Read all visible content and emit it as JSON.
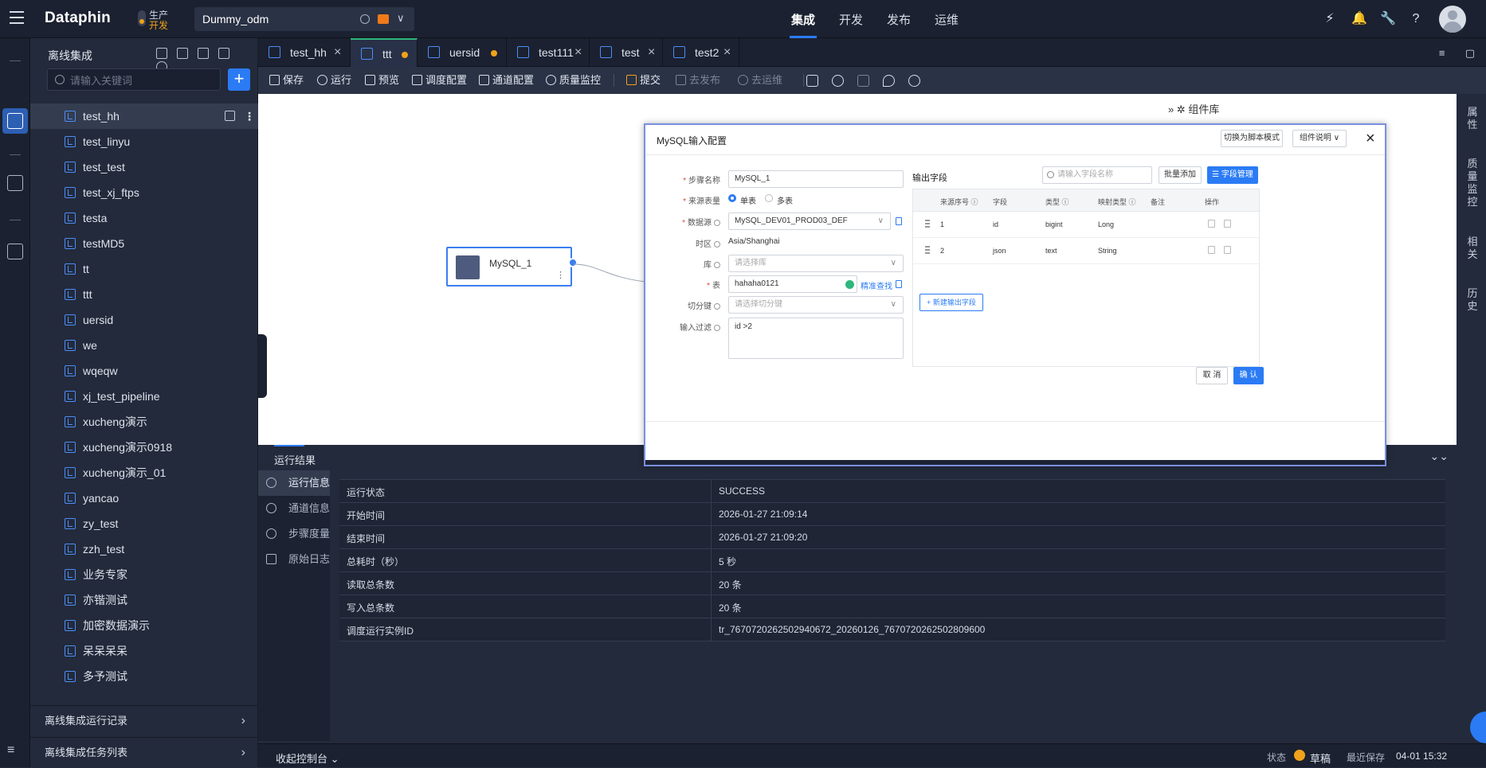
{
  "topbar": {
    "logo": "Dataphin",
    "env_line1": "生产",
    "env_line2": "开发",
    "project": "Dummy_odm",
    "nav": [
      "集成",
      "开发",
      "发布",
      "运维"
    ],
    "active_nav": "集成"
  },
  "sidebar": {
    "title": "离线集成",
    "search_placeholder": "请输入关键词",
    "items": [
      "test_hh",
      "test_linyu",
      "test_test",
      "test_xj_ftps",
      "testa",
      "testMD5",
      "tt",
      "ttt",
      "uersid",
      "we",
      "wqeqw",
      "xj_test_pipeline",
      "xucheng演示",
      "xucheng演示0918",
      "xucheng演示_01",
      "yancao",
      "zy_test",
      "zzh_test",
      "业务专家",
      "亦锴测试",
      "加密数据演示",
      "呆呆呆呆",
      "多予测试"
    ],
    "footer1": "离线集成运行记录",
    "footer2": "离线集成任务列表"
  },
  "tabs": [
    {
      "label": "test_hh",
      "modified": false,
      "active": false
    },
    {
      "label": "ttt",
      "modified": true,
      "active": true
    },
    {
      "label": "uersid",
      "modified": true,
      "active": false
    },
    {
      "label": "test111",
      "modified": false,
      "active": false
    },
    {
      "label": "test",
      "modified": false,
      "active": false
    },
    {
      "label": "test2",
      "modified": false,
      "active": false
    }
  ],
  "toolbar": {
    "save": "保存",
    "run": "运行",
    "preview": "预览",
    "schedule": "调度配置",
    "channel": "通道配置",
    "quality": "质量监控",
    "submit": "提交",
    "publish": "去发布",
    "ops": "去运维"
  },
  "canvas": {
    "node_label": "MySQL_1",
    "component_library": "组件库"
  },
  "right_rail": [
    "属性",
    "质量监控",
    "相关",
    "历史"
  ],
  "dialog": {
    "title": "MySQL输入配置",
    "btn_script": "切换为脚本模式",
    "btn_help": "组件说明",
    "step_name_label": "步骤名称",
    "step_name": "MySQL_1",
    "source_type_label": "来源表量",
    "single_table": "单表",
    "multi_table": "多表",
    "datasource_label": "数据源",
    "datasource": "MySQL_DEV01_PROD03_DEF",
    "timezone_label": "时区",
    "timezone": "Asia/Shanghai",
    "db_label": "库",
    "db_placeholder": "请选择库",
    "table_label": "表",
    "table": "hahaha0121",
    "exact_search": "精准查找",
    "split_key_label": "切分键",
    "split_key_placeholder": "请选择切分键",
    "filter_label": "输入过滤",
    "filter": "id >2",
    "output_title": "输出字段",
    "output_search_placeholder": "请输入字段名称",
    "batch_add": "批量添加",
    "field_manage": "字段管理",
    "columns": [
      "来源序号",
      "字段",
      "类型",
      "映射类型",
      "备注",
      "操作"
    ],
    "rows": [
      {
        "idx": "1",
        "field": "id",
        "type": "bigint",
        "mapped": "Long"
      },
      {
        "idx": "2",
        "field": "json",
        "type": "text",
        "mapped": "String"
      }
    ],
    "new_field": "新建输出字段",
    "cancel": "取 消",
    "confirm": "确 认"
  },
  "bottom": {
    "title": "运行结果",
    "side": [
      "运行信息",
      "通道信息",
      "步骤度量",
      "原始日志"
    ],
    "rows": [
      {
        "k": "运行状态",
        "v": "SUCCESS"
      },
      {
        "k": "开始时间",
        "v": "2026-01-27 21:09:14"
      },
      {
        "k": "结束时间",
        "v": "2026-01-27 21:09:20"
      },
      {
        "k": "总耗时（秒）",
        "v": "5 秒"
      },
      {
        "k": "读取总条数",
        "v": "20 条"
      },
      {
        "k": "写入总条数",
        "v": "20 条"
      },
      {
        "k": "调度运行实例ID",
        "v": "tr_7670720262502940672_20260126_7670720262502809600"
      }
    ]
  },
  "status": {
    "console": "收起控制台",
    "state_label": "状态",
    "state": "草稿",
    "saved_label": "最近保存",
    "saved": "04-01 15:32"
  },
  "colors": {
    "accent": "#2b7bf5",
    "warn": "#f0a21a",
    "success": "#2fb67c"
  }
}
